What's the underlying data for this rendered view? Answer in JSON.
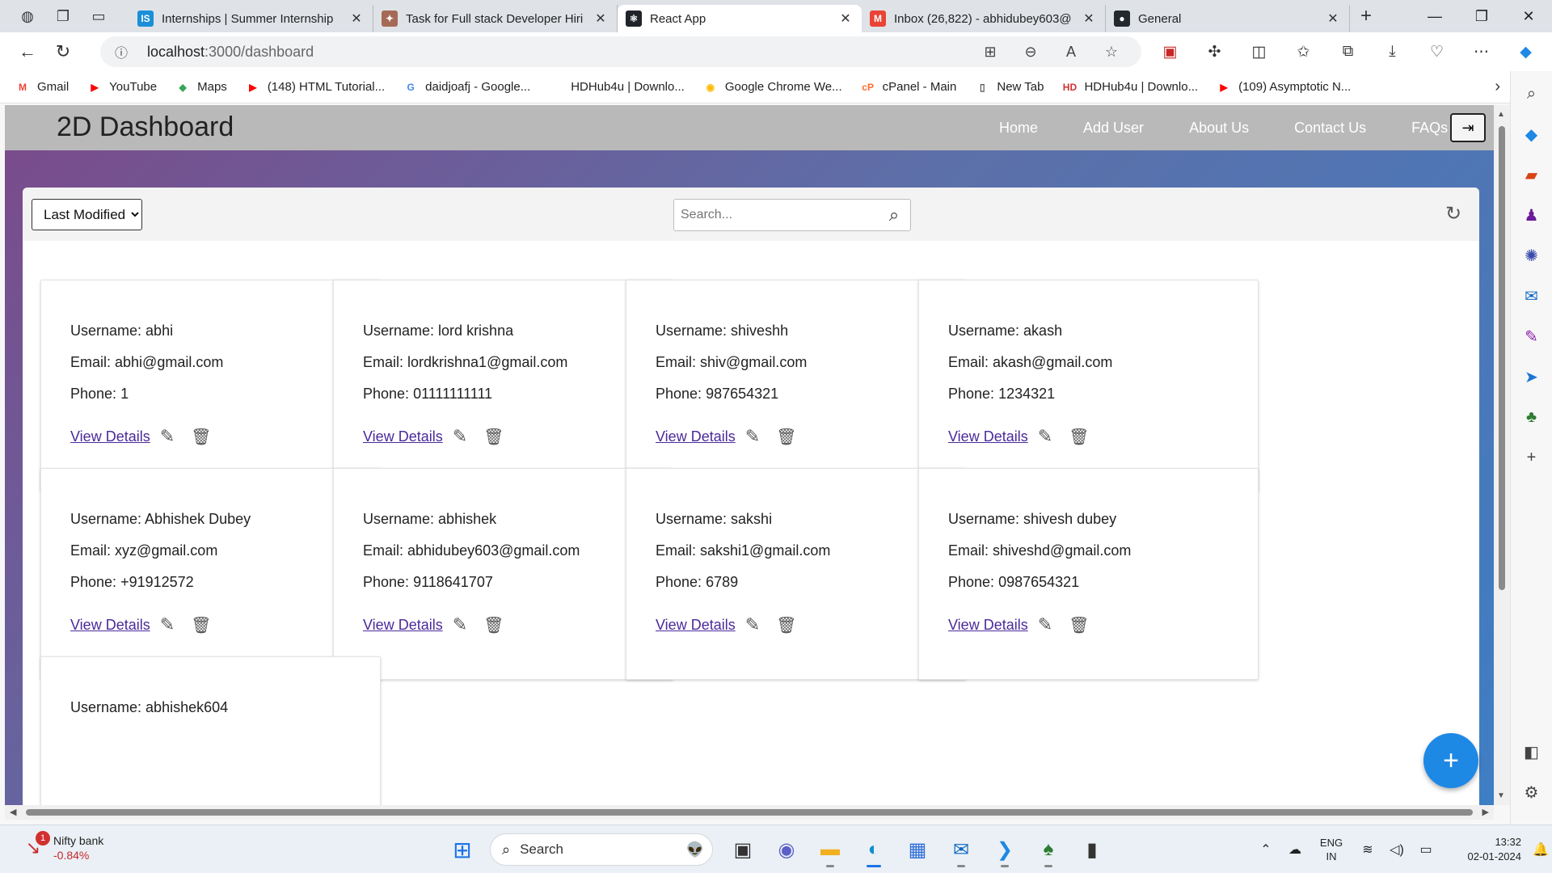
{
  "browser": {
    "tabs": [
      {
        "title": "Internships | Summer Internship",
        "icon": "internshala-favicon",
        "color": "#1b8fd8",
        "glyph": "IS",
        "active": false
      },
      {
        "title": "Task for Full stack Developer Hiri",
        "icon": "task-favicon",
        "color": "#a56a55",
        "glyph": "✦",
        "active": false
      },
      {
        "title": "React App",
        "icon": "react-favicon",
        "color": "#20232a",
        "glyph": "⚛",
        "active": true
      },
      {
        "title": "Inbox (26,822) - abhidubey603@",
        "icon": "gmail-favicon",
        "color": "#ea4335",
        "glyph": "M",
        "active": false
      },
      {
        "title": "General",
        "icon": "github-favicon",
        "color": "#24292e",
        "glyph": "●",
        "active": false
      }
    ],
    "address": {
      "host": "localhost",
      "path": ":3000/dashboard"
    },
    "bookmarks": [
      {
        "label": "Gmail",
        "icon": "gmail-icon",
        "color": "#ea4335",
        "glyph": "M"
      },
      {
        "label": "YouTube",
        "icon": "youtube-icon",
        "color": "#ff0000",
        "glyph": "▶"
      },
      {
        "label": "Maps",
        "icon": "maps-icon",
        "color": "#34a853",
        "glyph": "◆"
      },
      {
        "label": "(148) HTML Tutorial...",
        "icon": "youtube-icon",
        "color": "#ff0000",
        "glyph": "▶"
      },
      {
        "label": "daidjoafj - Google...",
        "icon": "google-icon",
        "color": "#4285f4",
        "glyph": "G"
      },
      {
        "label": "HDHub4u | Downlo...",
        "icon": "blank-page-icon",
        "color": "#ffffff",
        "glyph": ""
      },
      {
        "label": "Google Chrome We...",
        "icon": "chrome-icon",
        "color": "#fbbc05",
        "glyph": "◉"
      },
      {
        "label": "cPanel - Main",
        "icon": "cpanel-icon",
        "color": "#ff6c2c",
        "glyph": "cP"
      },
      {
        "label": "New Tab",
        "icon": "page-icon",
        "color": "#ffffff",
        "glyph": "▯"
      },
      {
        "label": "HDHub4u | Downlo...",
        "icon": "hd-icon",
        "color": "#d32f2f",
        "glyph": "HD"
      },
      {
        "label": "(109) Asymptotic N...",
        "icon": "youtube-icon",
        "color": "#ff0000",
        "glyph": "▶"
      }
    ]
  },
  "app": {
    "brand": "2D Dashboard",
    "nav": [
      "Home",
      "Add User",
      "About Us",
      "Contact Us",
      "FAQs"
    ],
    "sort": {
      "selected": "Last Modified"
    },
    "search": {
      "placeholder": "Search..."
    },
    "labels": {
      "username": "Username: ",
      "email": "Email: ",
      "phone": "Phone: ",
      "view": "View Details"
    },
    "users": [
      {
        "username": "abhi",
        "email": "abhi@gmail.com",
        "phone": "1"
      },
      {
        "username": "lord krishna",
        "email": "lordkrishna1@gmail.com",
        "phone": "01111111111"
      },
      {
        "username": "shiveshh",
        "email": "shiv@gmail.com",
        "phone": "987654321"
      },
      {
        "username": "akash",
        "email": "akash@gmail.com",
        "phone": "1234321"
      },
      {
        "username": "Abhishek Dubey",
        "email": "xyz@gmail.com",
        "phone": "+91912572"
      },
      {
        "username": "abhishek",
        "email": "abhidubey603@gmail.com",
        "phone": "9118641707"
      },
      {
        "username": "sakshi",
        "email": "sakshi1@gmail.com",
        "phone": "6789"
      },
      {
        "username": "shivesh dubey",
        "email": "shiveshd@gmail.com",
        "phone": "0987654321"
      },
      {
        "username": "abhishek604",
        "email": "",
        "phone": ""
      }
    ]
  },
  "taskbar": {
    "stock": {
      "name": "Nifty bank",
      "change": "-0.84%",
      "badge": "1"
    },
    "search_label": "Search",
    "lang": {
      "line1": "ENG",
      "line2": "IN"
    },
    "clock": {
      "time": "13:32",
      "date": "02-01-2024"
    }
  }
}
